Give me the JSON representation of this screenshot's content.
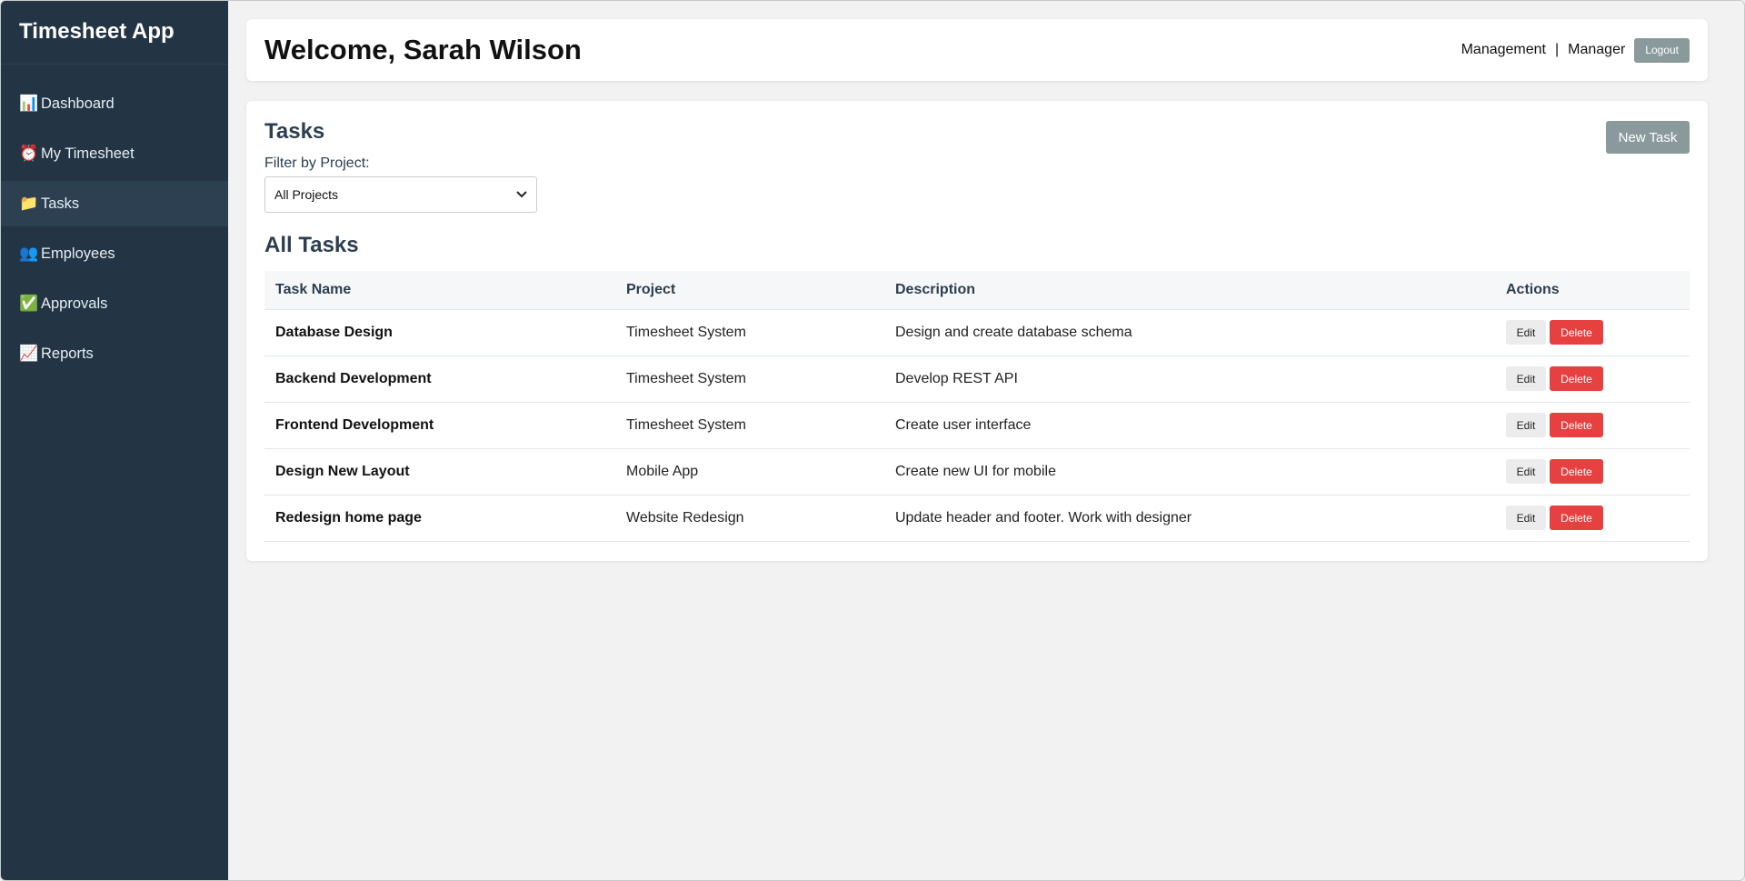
{
  "app": {
    "title": "Timesheet App"
  },
  "sidebar": {
    "items": [
      {
        "icon": "📊",
        "icon_name": "chart-icon",
        "label": "Dashboard",
        "active": false
      },
      {
        "icon": "⏰",
        "icon_name": "alarm-clock-icon",
        "label": "My Timesheet",
        "active": false
      },
      {
        "icon": "📁",
        "icon_name": "folder-icon",
        "label": "Tasks",
        "active": true
      },
      {
        "icon": "👥",
        "icon_name": "people-icon",
        "label": "Employees",
        "active": false
      },
      {
        "icon": "✅",
        "icon_name": "check-icon",
        "label": "Approvals",
        "active": false
      },
      {
        "icon": "📈",
        "icon_name": "trend-icon",
        "label": "Reports",
        "active": false
      }
    ]
  },
  "header": {
    "welcome": "Welcome, Sarah Wilson",
    "department": "Management",
    "separator": "|",
    "role": "Manager",
    "logout_label": "Logout"
  },
  "tasks": {
    "title": "Tasks",
    "new_task_label": "New Task",
    "filter_label": "Filter by Project:",
    "filter_selected": "All Projects",
    "list_title": "All Tasks",
    "columns": [
      "Task Name",
      "Project",
      "Description",
      "Actions"
    ],
    "rows": [
      {
        "name": "Database Design",
        "project": "Timesheet System",
        "description": "Design and create database schema"
      },
      {
        "name": "Backend Development",
        "project": "Timesheet System",
        "description": "Develop REST API"
      },
      {
        "name": "Frontend Development",
        "project": "Timesheet System",
        "description": "Create user interface"
      },
      {
        "name": "Design New Layout",
        "project": "Mobile App",
        "description": "Create new UI for mobile"
      },
      {
        "name": "Redesign home page",
        "project": "Website Redesign",
        "description": "Update header and footer. Work with designer"
      }
    ],
    "edit_label": "Edit",
    "delete_label": "Delete"
  },
  "colors": {
    "sidebar_bg": "#233445",
    "sidebar_active": "#2c4052",
    "muted_button": "#8a9a9c",
    "delete_button": "#e74040"
  }
}
